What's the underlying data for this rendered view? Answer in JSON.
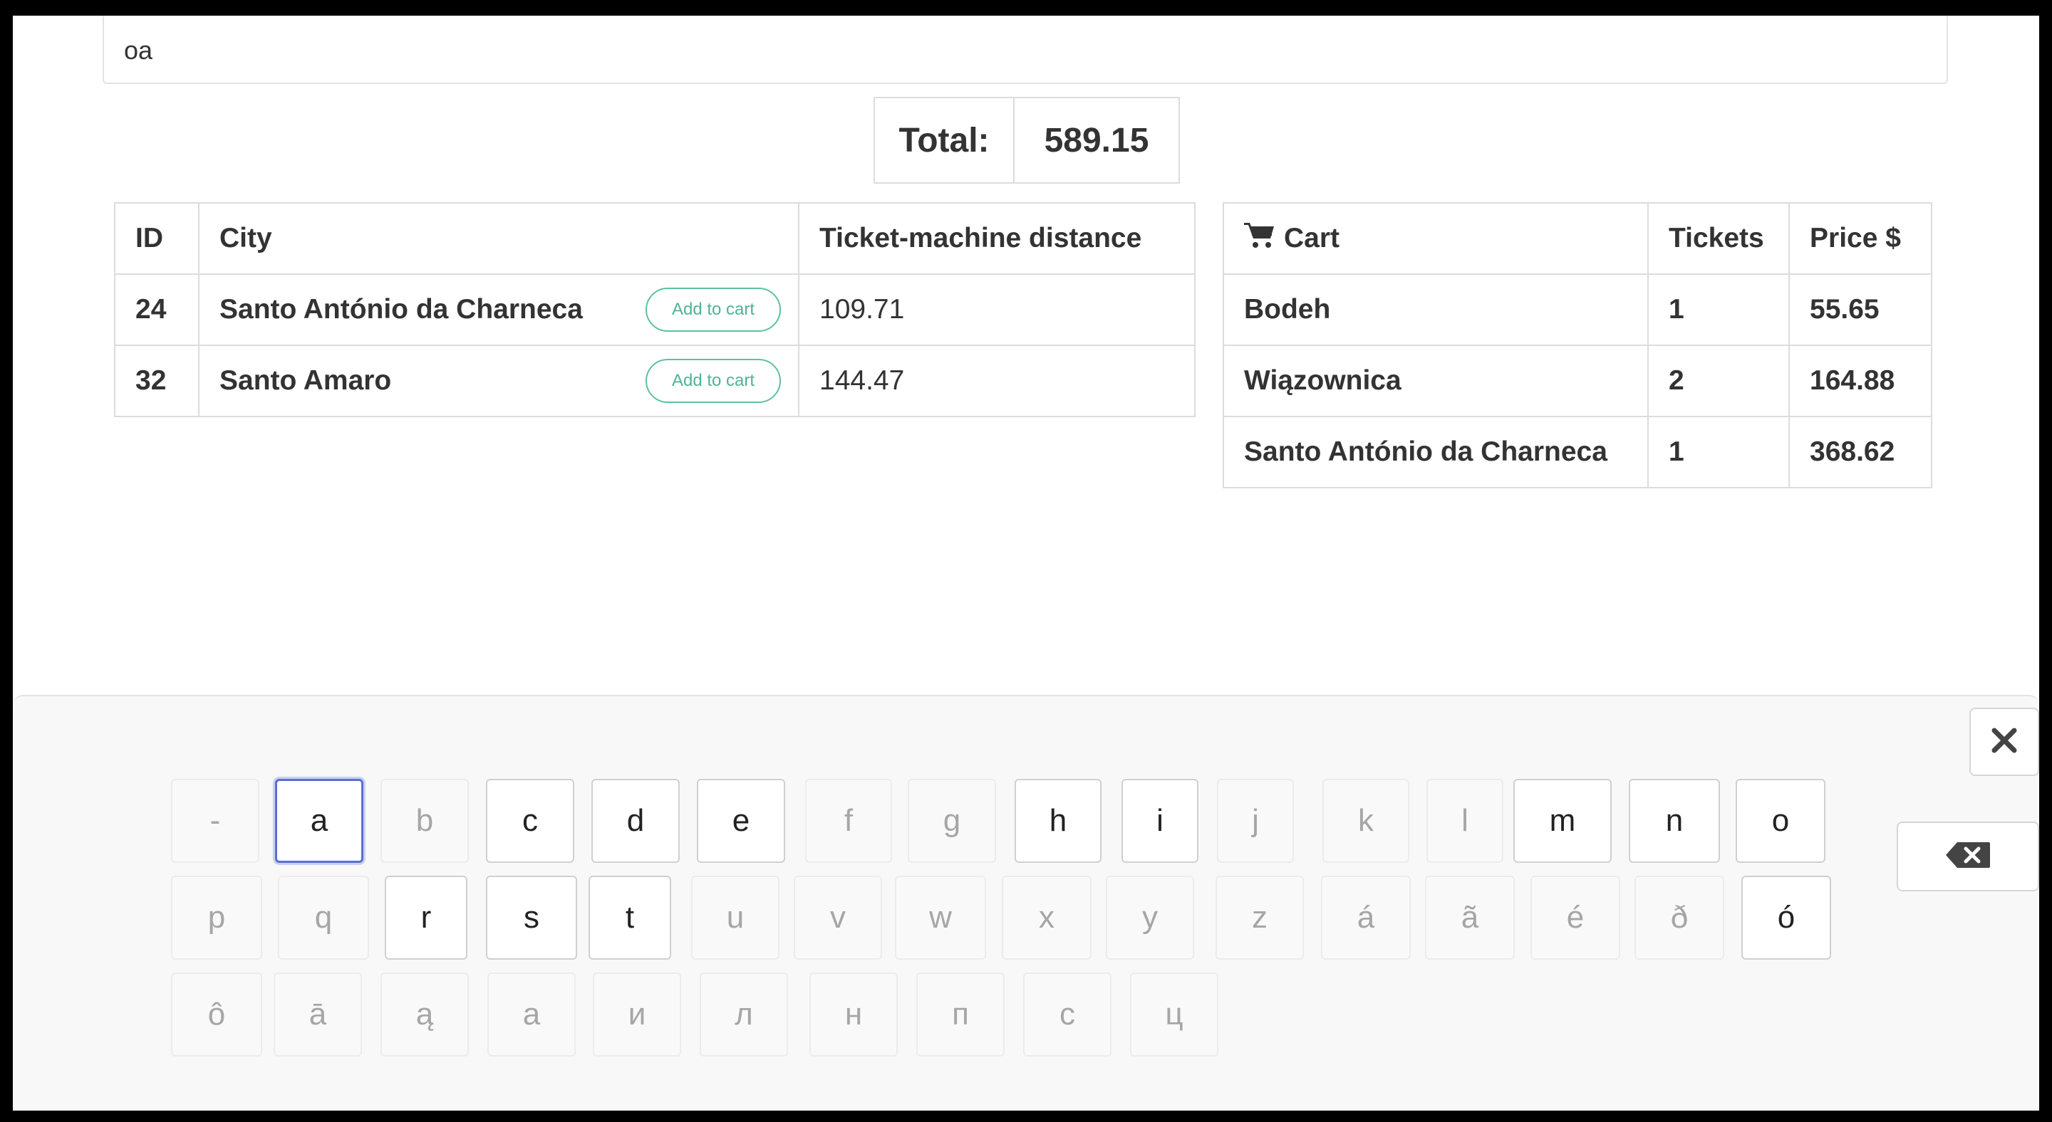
{
  "search": {
    "value": "oa"
  },
  "total": {
    "label": "Total:",
    "value": "589.15"
  },
  "results": {
    "headers": [
      "ID",
      "City",
      "Ticket-machine distance"
    ],
    "add_label": "Add to cart",
    "rows": [
      {
        "id": "24",
        "city": "Santo António da Charneca",
        "distance": "109.71"
      },
      {
        "id": "32",
        "city": "Santo Amaro",
        "distance": "144.47"
      }
    ]
  },
  "cart": {
    "icon": "shopping-cart-icon",
    "headers": [
      "Cart",
      "Tickets",
      "Price $"
    ],
    "rows": [
      {
        "name": "Bodeh",
        "tickets": "1",
        "price": "55.65"
      },
      {
        "name": "Wiązownica",
        "tickets": "2",
        "price": "164.88"
      },
      {
        "name": "Santo António da Charneca",
        "tickets": "1",
        "price": "368.62"
      }
    ]
  },
  "keyboard": {
    "close_icon": "close-icon",
    "backspace_icon": "backspace-icon",
    "rows": [
      [
        "-",
        "a",
        "b",
        "c",
        "d",
        "e",
        "f",
        "g",
        "h",
        "i",
        "j",
        "k",
        "l",
        "m",
        "n",
        "o"
      ],
      [
        "p",
        "q",
        "r",
        "s",
        "t",
        "u",
        "v",
        "w",
        "x",
        "y",
        "z",
        "á",
        "ã",
        "é",
        "ð",
        "ó"
      ],
      [
        "ô",
        "ā",
        "ą",
        "а",
        "и",
        "л",
        "н",
        "п",
        "с",
        "ц"
      ]
    ],
    "enabled_keys": [
      "a",
      "c",
      "d",
      "e",
      "h",
      "i",
      "m",
      "n",
      "o",
      "r",
      "s",
      "t",
      "ó"
    ],
    "highlighted_key": "a"
  }
}
